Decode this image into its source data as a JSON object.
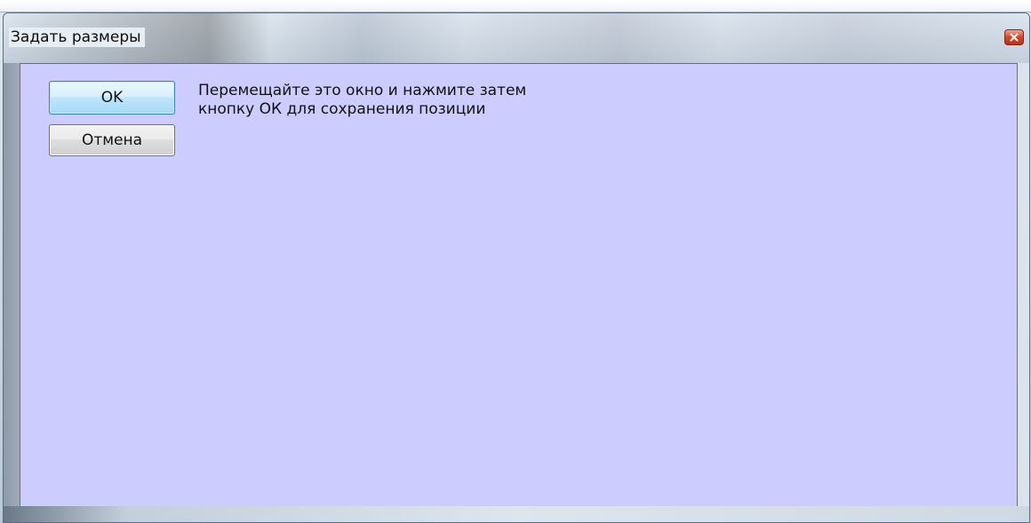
{
  "window": {
    "title": "Задать размеры",
    "close_icon": "close-icon"
  },
  "dialog": {
    "ok_label": "OK",
    "cancel_label": "Отмена",
    "message_line1": "Перемещайте это окно и нажмите затем",
    "message_line2": "кнопку ОК для сохранения позиции"
  },
  "colors": {
    "client_background": "#ccccff",
    "close_button": "#d2462a",
    "ok_border": "#3c7fb1"
  }
}
